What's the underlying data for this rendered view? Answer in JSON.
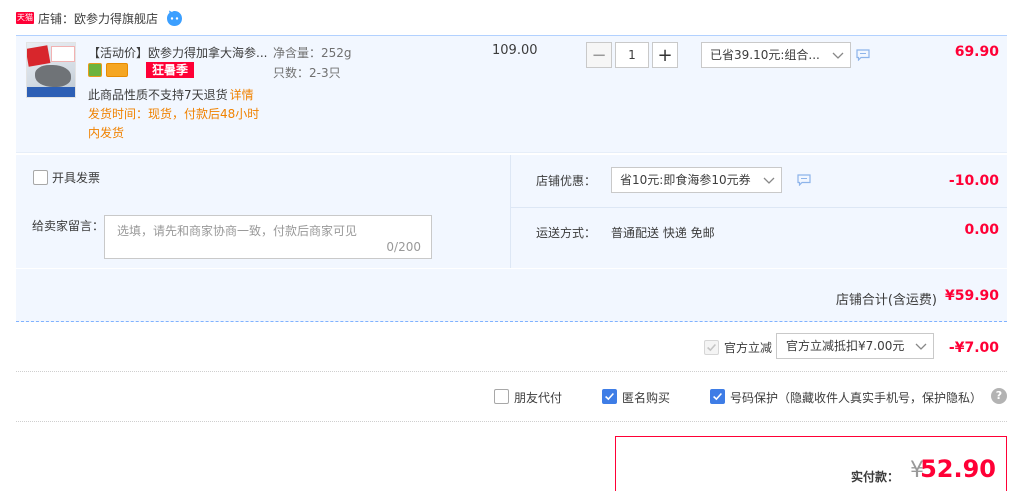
{
  "store": {
    "badge": "天猫",
    "label": "店铺：欧参力得旗舰店"
  },
  "item": {
    "title": "【活动价】欧参力得加拿大海参...",
    "promo_tag": "狂暑季",
    "no_return_text": "此商品性质不支持7天退货",
    "detail_link": "详情",
    "ship_time": "发货时间：现货，付款后48小时内发货",
    "sku_weight": "净含量：252g",
    "sku_count": "只数：2-3只",
    "unit_price": "109.00",
    "quantity_minus": "−",
    "quantity": "1",
    "quantity_plus": "+",
    "promo_selected": "已省39.10元:组合...",
    "total": "69.90"
  },
  "shop_options": {
    "invoice_label": "开具发票",
    "message_label": "给卖家留言：",
    "message_placeholder": "选填，请先和商家协商一致，付款后商家可见",
    "message_count": "0/200",
    "discount_label": "店铺优惠：",
    "coupon_selected": "省10元:即食海参10元券",
    "discount_value": "-10.00",
    "shipping_label": "运送方式：",
    "shipping_method": "普通配送 快递 免邮",
    "shipping_fee": "0.00",
    "subtotal_label": "店铺合计(含运费)",
    "subtotal_value": "¥59.90"
  },
  "official": {
    "label": "官方立减",
    "selected": "官方立减抵扣¥7.00元",
    "value": "-¥7.00"
  },
  "options": {
    "friend_pay": "朋友代付",
    "anonymous": "匿名购买",
    "number_protect": "号码保护（隐藏收件人真实手机号，保护隐私）",
    "help": "?"
  },
  "payment": {
    "label": "实付款：",
    "currency": "¥",
    "amount": "52.90"
  },
  "colors": {
    "accent_red": "#ff0036",
    "panel_bg": "#f2f7ff",
    "check_blue": "#3e7de6",
    "warn_orange": "#f08200"
  }
}
